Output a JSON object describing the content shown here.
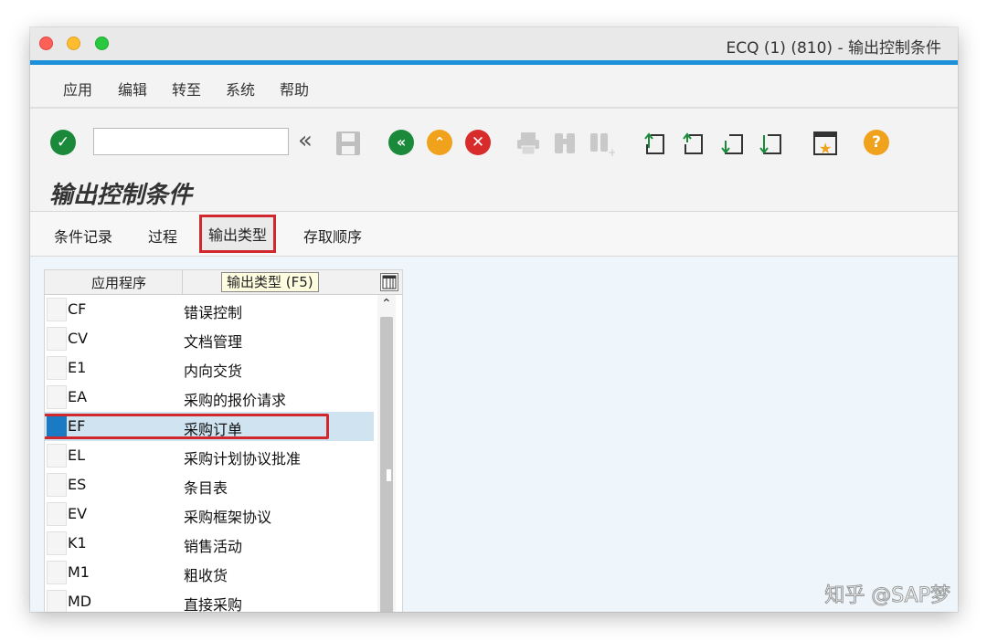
{
  "window": {
    "title": "ECQ (1) (810) - 输出控制条件"
  },
  "menubar": {
    "items": [
      "应用",
      "编辑",
      "转至",
      "系统",
      "帮助"
    ]
  },
  "toolbar": {
    "command_field_value": "",
    "icons": [
      "enter-icon",
      "back-chevrons-icon",
      "save-icon",
      "back-icon",
      "exit-icon",
      "cancel-icon",
      "print-icon",
      "find-icon",
      "find-next-icon",
      "first-page-icon",
      "previous-page-icon",
      "next-page-icon",
      "last-page-icon",
      "bookmark-icon",
      "help-icon"
    ]
  },
  "page": {
    "title": "输出控制条件"
  },
  "app_toolbar": {
    "buttons": [
      "条件记录",
      "过程",
      "输出类型",
      "存取顺序"
    ],
    "selected": "输出类型"
  },
  "table": {
    "columns": [
      "应用程序",
      "输出类型 (F5)"
    ],
    "rows": [
      {
        "code": "CF",
        "desc": "错误控制"
      },
      {
        "code": "CV",
        "desc": "文档管理"
      },
      {
        "code": "E1",
        "desc": "内向交货"
      },
      {
        "code": "EA",
        "desc": "采购的报价请求"
      },
      {
        "code": "EF",
        "desc": "采购订单",
        "selected": true
      },
      {
        "code": "EL",
        "desc": "采购计划协议批准"
      },
      {
        "code": "ES",
        "desc": "条目表"
      },
      {
        "code": "EV",
        "desc": "采购框架协议"
      },
      {
        "code": "K1",
        "desc": "销售活动"
      },
      {
        "code": "M1",
        "desc": "粗收货"
      },
      {
        "code": "MD",
        "desc": "直接采购"
      }
    ]
  },
  "watermark": "知乎 @SAP梦"
}
